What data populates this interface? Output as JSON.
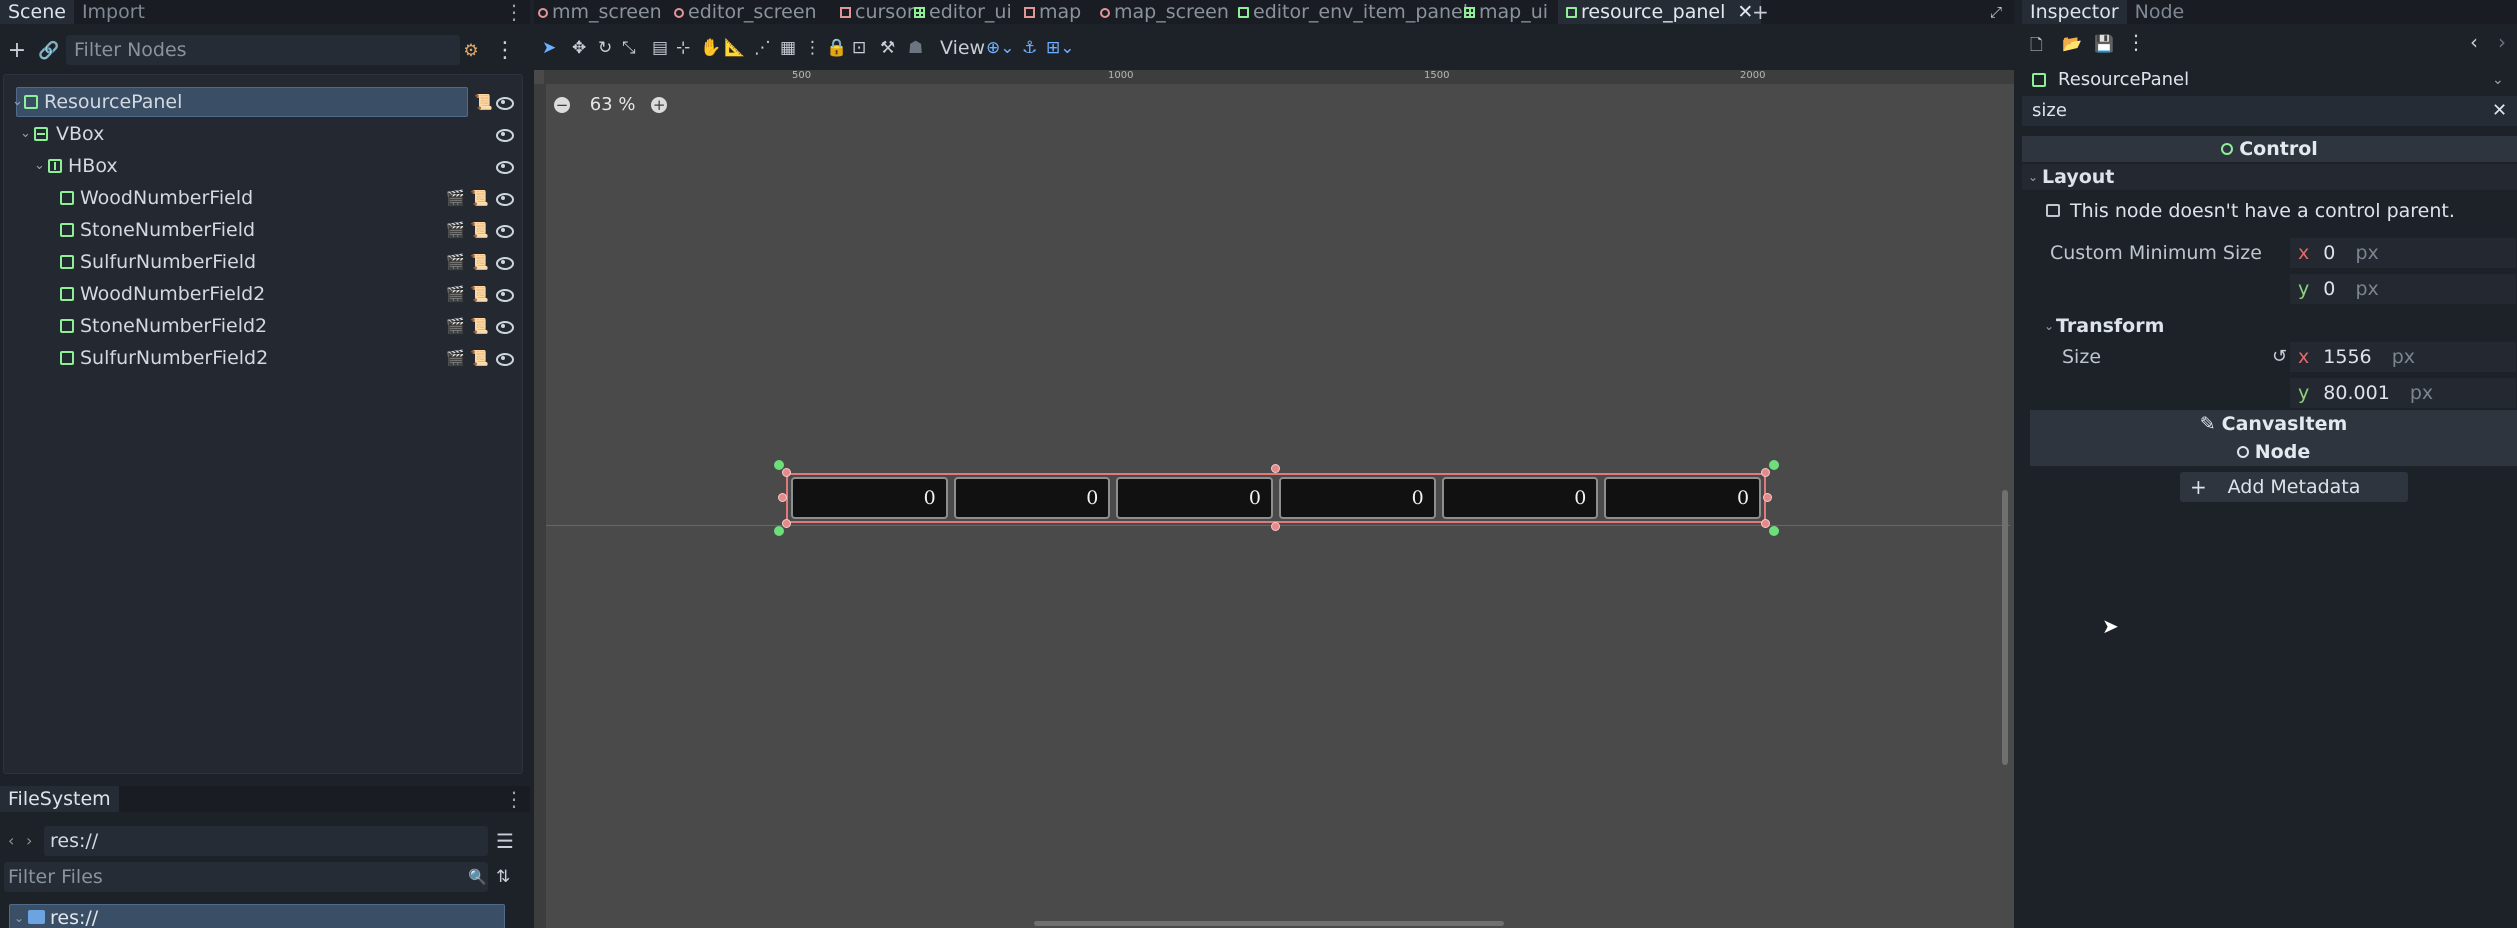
{
  "left_dock": {
    "tabs": [
      "Scene",
      "Import"
    ],
    "filter_placeholder": "Filter Nodes",
    "tree": [
      {
        "label": "ResourcePanel",
        "depth": 0,
        "type": "control",
        "selected": true
      },
      {
        "label": "VBox",
        "depth": 1,
        "type": "vbox"
      },
      {
        "label": "HBox",
        "depth": 2,
        "type": "hbox"
      },
      {
        "label": "WoodNumberField",
        "depth": 3,
        "type": "control"
      },
      {
        "label": "StoneNumberField",
        "depth": 3,
        "type": "control"
      },
      {
        "label": "SulfurNumberField",
        "depth": 3,
        "type": "control"
      },
      {
        "label": "WoodNumberField2",
        "depth": 3,
        "type": "control"
      },
      {
        "label": "StoneNumberField2",
        "depth": 3,
        "type": "control"
      },
      {
        "label": "SulfurNumberField2",
        "depth": 3,
        "type": "control"
      }
    ]
  },
  "filesystem": {
    "tab": "FileSystem",
    "path": "res://",
    "filter_placeholder": "Filter Files",
    "root": "res://"
  },
  "scene_tabs": [
    {
      "label": "mm_screen",
      "icon": "circle"
    },
    {
      "label": "editor_screen",
      "icon": "circle"
    },
    {
      "label": "cursor",
      "icon": "camera"
    },
    {
      "label": "editor_ui",
      "icon": "grid"
    },
    {
      "label": "map",
      "icon": "camera"
    },
    {
      "label": "map_screen",
      "icon": "circle"
    },
    {
      "label": "editor_env_item_panel",
      "icon": "square"
    },
    {
      "label": "map_ui",
      "icon": "grid"
    },
    {
      "label": "resource_panel",
      "icon": "square",
      "active": true
    }
  ],
  "viewport": {
    "view_menu": "View",
    "zoom": "63 %",
    "ruler_marks": [
      "500",
      "1000",
      "1500",
      "2000"
    ],
    "fields": [
      "0",
      "0",
      "0",
      "0",
      "0",
      "0"
    ]
  },
  "inspector": {
    "tabs": [
      "Inspector",
      "Node"
    ],
    "object_name": "ResourcePanel",
    "search": "size",
    "class_header": "Control",
    "layout_label": "Layout",
    "warning": "This node doesn't have a control parent.",
    "custom_min_size": {
      "label": "Custom Minimum Size",
      "x": "0",
      "y": "0",
      "unit": "px"
    },
    "transform_label": "Transform",
    "size": {
      "label": "Size",
      "x": "1556",
      "y": "80.001",
      "unit": "px"
    },
    "canvas_item": "CanvasItem",
    "node_header": "Node",
    "add_metadata": "Add Metadata"
  },
  "colors": {
    "accent": "#6fb1ff",
    "control_node": "#8eef97",
    "selection": "#e07a7a"
  }
}
